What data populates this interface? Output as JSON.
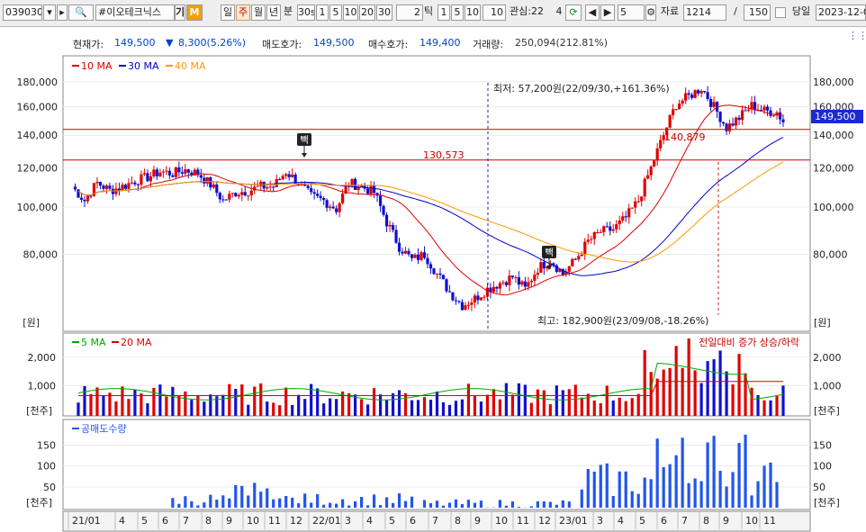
{
  "toolbar": {
    "code": "039030",
    "name": "#이오테크닉스",
    "period_buttons": [
      "일",
      "주",
      "월",
      "년"
    ],
    "selected_period": "주",
    "minute_label": "분",
    "min_options": [
      "30s",
      "1",
      "5",
      "10",
      "20",
      "30"
    ],
    "tick_value": "2",
    "tick_label": "틱",
    "tick_options": [
      "1",
      "5",
      "10"
    ],
    "interest_label": "관심:22",
    "interest_count": "4",
    "step_value": "5",
    "data_label": "자료",
    "data_value": "1214",
    "slash": "/",
    "page_value": "150",
    "same_day_label": "당일",
    "date_value": "2023-12-0"
  },
  "info": {
    "price_label": "현재가:",
    "price": "149,500",
    "change": "8,300(5.26%)",
    "ask_label": "매도호가:",
    "ask": "149,500",
    "bid_label": "매수호가:",
    "bid": "149,400",
    "volume_label": "거래량:",
    "volume": "250,094(212.81%)"
  },
  "price_pane": {
    "legend": [
      "10 MA",
      "30 MA",
      "40 MA"
    ],
    "legend_colors": [
      "#dd0000",
      "#0000cc",
      "#ff9900"
    ],
    "y_ticks": [
      "180,000",
      "160,000",
      "140,000",
      "120,000",
      "100,000",
      "80,000"
    ],
    "unit": "[원]",
    "current_price_tag": "149,500",
    "low_annotation": "최저: 57,200원(22/09/30,+161.36%)",
    "high_annotation": "최고: 182,900원(23/09/08,-18.26%)",
    "line_a_label": "130,573",
    "line_b_label": "140,879",
    "marker_label": "빽"
  },
  "volume_pane": {
    "legend": [
      "5 MA",
      "20 MA"
    ],
    "legend_colors": [
      "#00aa00",
      "#dd0000"
    ],
    "note": "전일대비 증가 상승/하락",
    "y_ticks": [
      "2,000",
      "1,000"
    ],
    "unit": "[천주]"
  },
  "short_pane": {
    "legend": "공매도수량",
    "legend_color": "#2255ee",
    "y_ticks": [
      "150",
      "100",
      "50"
    ],
    "unit": "[천주]"
  },
  "x_axis": [
    "21/01",
    "4",
    "5",
    "6",
    "7",
    "8",
    "9",
    "10",
    "11",
    "12",
    "22/01",
    "3",
    "4",
    "5",
    "6",
    "7",
    "8",
    "9",
    "10",
    "11",
    "12",
    "23/01",
    "3",
    "4",
    "5",
    "6",
    "7",
    "8",
    "9",
    "10",
    "11"
  ],
  "chart_data": {
    "type": "candlestick",
    "x_labels": [
      "21/01",
      "4",
      "5",
      "6",
      "7",
      "8",
      "9",
      "10",
      "11",
      "12",
      "22/01",
      "3",
      "4",
      "5",
      "6",
      "7",
      "8",
      "9",
      "10",
      "11",
      "12",
      "23/01",
      "3",
      "4",
      "5",
      "6",
      "7",
      "8",
      "9",
      "10",
      "11"
    ],
    "price_anchors": [
      [
        0,
        110000
      ],
      [
        4,
        103000
      ],
      [
        8,
        112000
      ],
      [
        12,
        108000
      ],
      [
        16,
        110000
      ],
      [
        20,
        113000
      ],
      [
        24,
        115000
      ],
      [
        28,
        118000
      ],
      [
        32,
        117000
      ],
      [
        36,
        119000
      ],
      [
        40,
        117000
      ],
      [
        44,
        111000
      ],
      [
        48,
        103000
      ],
      [
        52,
        107000
      ],
      [
        56,
        108000
      ],
      [
        60,
        110000
      ],
      [
        64,
        110000
      ],
      [
        68,
        118000
      ],
      [
        72,
        112000
      ],
      [
        76,
        105000
      ],
      [
        80,
        103000
      ],
      [
        84,
        99000
      ],
      [
        88,
        112000
      ],
      [
        92,
        110000
      ],
      [
        96,
        107000
      ],
      [
        100,
        93000
      ],
      [
        104,
        83000
      ],
      [
        108,
        78000
      ],
      [
        112,
        80000
      ],
      [
        116,
        73000
      ],
      [
        120,
        67000
      ],
      [
        124,
        63000
      ],
      [
        128,
        65000
      ],
      [
        132,
        68000
      ],
      [
        136,
        70000
      ],
      [
        140,
        72000
      ],
      [
        144,
        68000
      ],
      [
        148,
        75000
      ],
      [
        152,
        78000
      ],
      [
        156,
        73000
      ],
      [
        160,
        78000
      ],
      [
        164,
        85000
      ],
      [
        168,
        89000
      ],
      [
        172,
        90000
      ],
      [
        176,
        95000
      ],
      [
        180,
        103000
      ],
      [
        184,
        120000
      ],
      [
        188,
        140000
      ],
      [
        192,
        162000
      ],
      [
        196,
        168000
      ],
      [
        200,
        175000
      ],
      [
        204,
        160000
      ],
      [
        208,
        145000
      ],
      [
        212,
        152000
      ],
      [
        216,
        161000
      ],
      [
        220,
        157000
      ],
      [
        224,
        156000
      ],
      [
        226,
        149500
      ]
    ],
    "ma_colors": {
      "MA10": "#dd0000",
      "MA30": "#0000cc",
      "MA40": "#ff9900"
    },
    "volume_ylim": [
      0,
      2600
    ],
    "short_ylim": [
      0,
      190
    ],
    "price_ylim_log": [
      57200,
      190000
    ]
  }
}
